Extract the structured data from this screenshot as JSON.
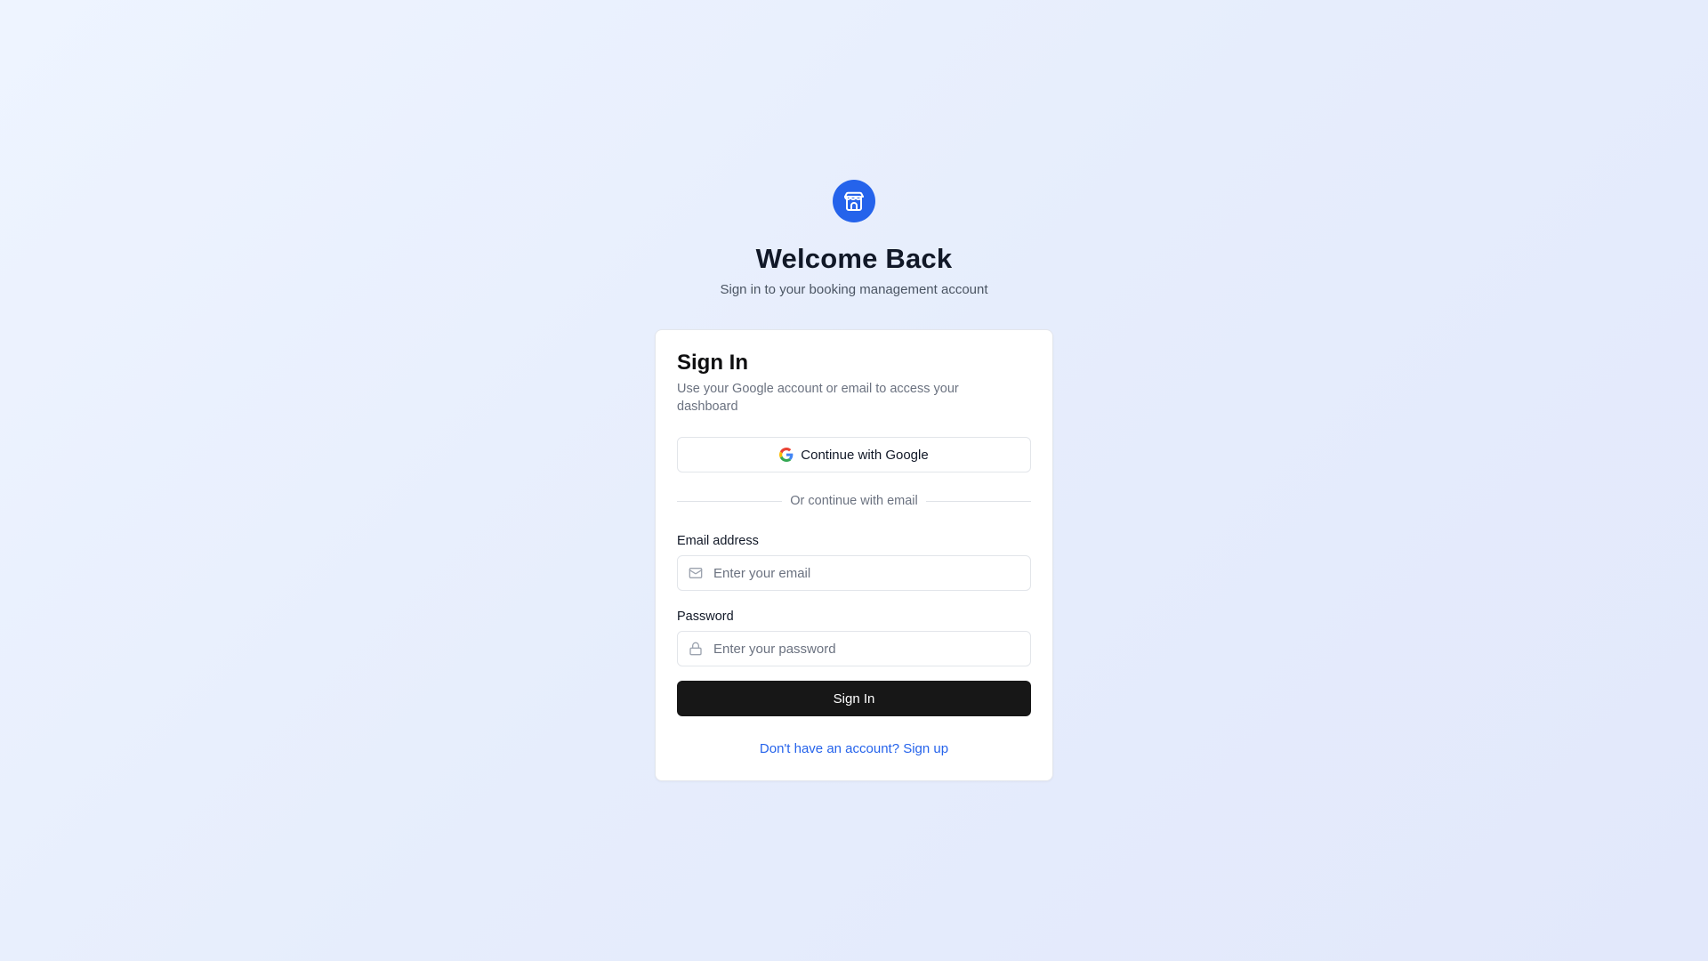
{
  "header": {
    "logo_icon": "store-icon",
    "title": "Welcome Back",
    "subtitle": "Sign in to your booking management account"
  },
  "card": {
    "title": "Sign In",
    "description": "Use your Google account or email to access your dashboard",
    "google_button": {
      "label": "Continue with Google",
      "icon": "google-icon"
    },
    "divider_text": "Or continue with email",
    "email": {
      "label": "Email address",
      "placeholder": "Enter your email",
      "value": "",
      "icon": "mail-icon"
    },
    "password": {
      "label": "Password",
      "placeholder": "Enter your password",
      "value": "",
      "icon": "lock-icon"
    },
    "submit_label": "Sign In",
    "signup_link": "Don't have an account? Sign up"
  },
  "colors": {
    "accent": "#2563eb",
    "primary_button": "#171717",
    "background_start": "#eef4ff",
    "background_end": "#e2e8fb"
  }
}
